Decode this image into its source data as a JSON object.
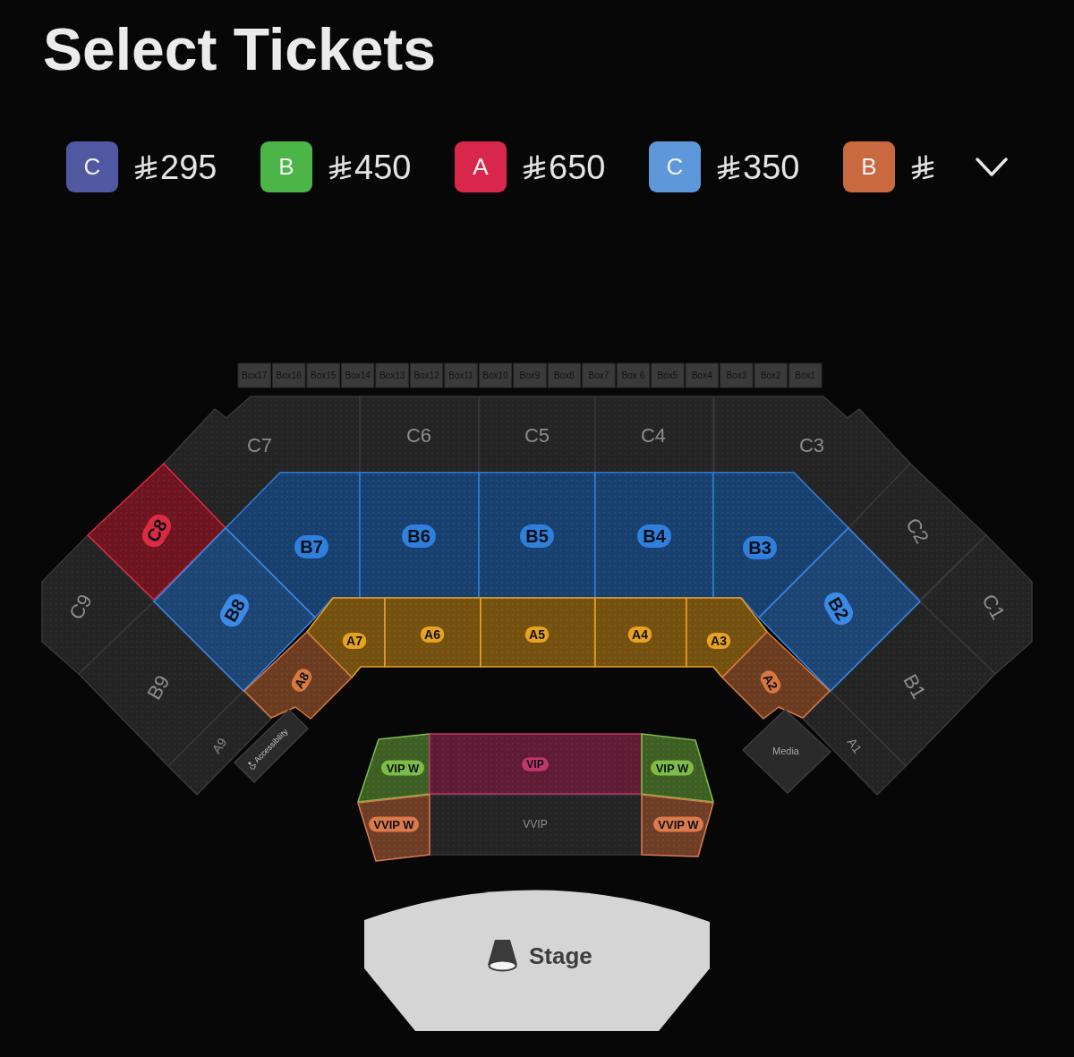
{
  "title": "Select Tickets",
  "price_tiers": [
    {
      "tier": "C",
      "color": "#4f58a0",
      "price": "295"
    },
    {
      "tier": "B",
      "color": "#4cb548",
      "price": "450"
    },
    {
      "tier": "A",
      "color": "#d8274b",
      "price": "650"
    },
    {
      "tier": "C",
      "color": "#5e98da",
      "price": "350"
    },
    {
      "tier": "B",
      "color": "#c8693f"
    }
  ],
  "seat_map": {
    "boxes": [
      "Box17",
      "Box16",
      "Box15",
      "Box14",
      "Box13",
      "Box12",
      "Box11",
      "Box10",
      "Box9",
      "Box8",
      "Box7",
      "Box 6",
      "Box5",
      "Box4",
      "Box3",
      "Box2",
      "Box1"
    ],
    "sections": [
      {
        "label": "C7",
        "available": false
      },
      {
        "label": "C6",
        "available": false
      },
      {
        "label": "C5",
        "available": false
      },
      {
        "label": "C4",
        "available": false
      },
      {
        "label": "C3",
        "available": false
      },
      {
        "label": "C8",
        "available": true,
        "color": "#dc2a40"
      },
      {
        "label": "B7",
        "available": true,
        "color": "#2f7fdd"
      },
      {
        "label": "B6",
        "available": true,
        "color": "#2f7fdd"
      },
      {
        "label": "B5",
        "available": true,
        "color": "#2f7fdd"
      },
      {
        "label": "B4",
        "available": true,
        "color": "#2f7fdd"
      },
      {
        "label": "B3",
        "available": true,
        "color": "#2f7fdd"
      },
      {
        "label": "C2",
        "available": false
      },
      {
        "label": "C9",
        "available": false
      },
      {
        "label": "B8",
        "available": true,
        "color": "#3a8ae8"
      },
      {
        "label": "A7",
        "available": true,
        "color": "#e9a21f"
      },
      {
        "label": "A6",
        "available": true,
        "color": "#e9a21f"
      },
      {
        "label": "A5",
        "available": true,
        "color": "#e9a21f"
      },
      {
        "label": "A4",
        "available": true,
        "color": "#e9a21f"
      },
      {
        "label": "A3",
        "available": true,
        "color": "#e9a21f"
      },
      {
        "label": "B2",
        "available": true,
        "color": "#3a8ae8"
      },
      {
        "label": "C1",
        "available": false
      },
      {
        "label": "B9",
        "available": false
      },
      {
        "label": "A8",
        "available": true,
        "color": "#d8773f"
      },
      {
        "label": "A2",
        "available": true,
        "color": "#d8773f"
      },
      {
        "label": "B1",
        "available": false
      },
      {
        "label": "A9",
        "available": false
      },
      {
        "label": "A1",
        "available": false
      },
      {
        "label": "VIP W",
        "available": true,
        "color": "#7cbd47"
      },
      {
        "label": "VIP",
        "available": true,
        "color": "#c0356a"
      },
      {
        "label": "VIP W",
        "available": true,
        "color": "#7cbd47"
      },
      {
        "label": "VVIP W",
        "available": true,
        "color": "#dc7a4b"
      },
      {
        "label": "VVIP",
        "available": false
      },
      {
        "label": "VVIP W",
        "available": true,
        "color": "#dc7a4b"
      }
    ],
    "areas": [
      {
        "kind": "accessibility",
        "label": "Accessibility"
      },
      {
        "kind": "media",
        "label": "Media"
      }
    ],
    "stage": {
      "label": "Stage"
    }
  }
}
